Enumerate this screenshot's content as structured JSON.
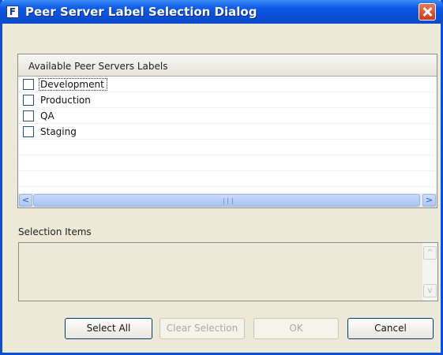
{
  "window": {
    "title": "Peer Server Label Selection Dialog",
    "icon_glyph": "F",
    "icon_name": "app-icon",
    "close_icon": "close-icon"
  },
  "list": {
    "header": "Available Peer Servers Labels",
    "items": [
      {
        "label": "Development",
        "checked": false
      },
      {
        "label": "Production",
        "checked": false
      },
      {
        "label": "QA",
        "checked": false
      },
      {
        "label": "Staging",
        "checked": false
      }
    ],
    "scroll_left_glyph": "<",
    "scroll_right_glyph": ">"
  },
  "selection": {
    "label": "Selection Items",
    "scroll_up_glyph": "^",
    "scroll_down_glyph": "v"
  },
  "buttons": {
    "select_all": "Select All",
    "clear_selection": "Clear Selection",
    "ok": "OK",
    "cancel": "Cancel"
  },
  "colors": {
    "title_bar": "#0a4fd6",
    "window_bg": "#ece9d8",
    "close_button": "#c93b1c"
  }
}
